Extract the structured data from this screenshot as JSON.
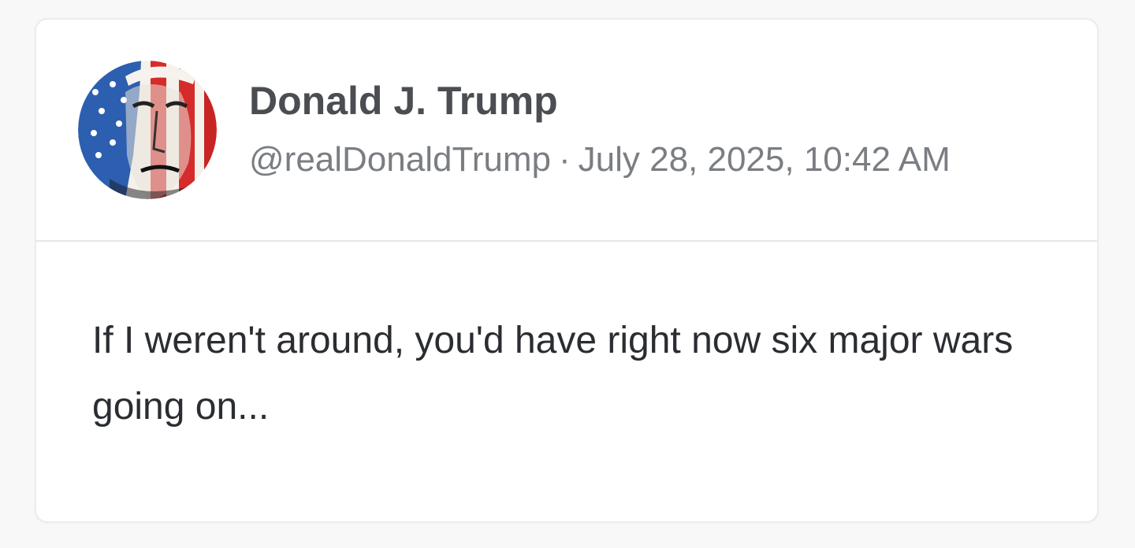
{
  "post": {
    "author": {
      "display_name": "Donald J. Trump",
      "handle": "@realDonaldTrump",
      "avatar_icon": "flag-portrait-avatar"
    },
    "separator": "·",
    "timestamp": "July 28, 2025, 10:42 AM",
    "body": "If I weren't around, you'd have right now six major wars going on..."
  },
  "colors": {
    "name_text": "#4a4e53",
    "meta_text": "#7a7e83",
    "body_text": "#2a2d31",
    "flag_red": "#d62b2b",
    "flag_blue": "#2d5fb0"
  }
}
